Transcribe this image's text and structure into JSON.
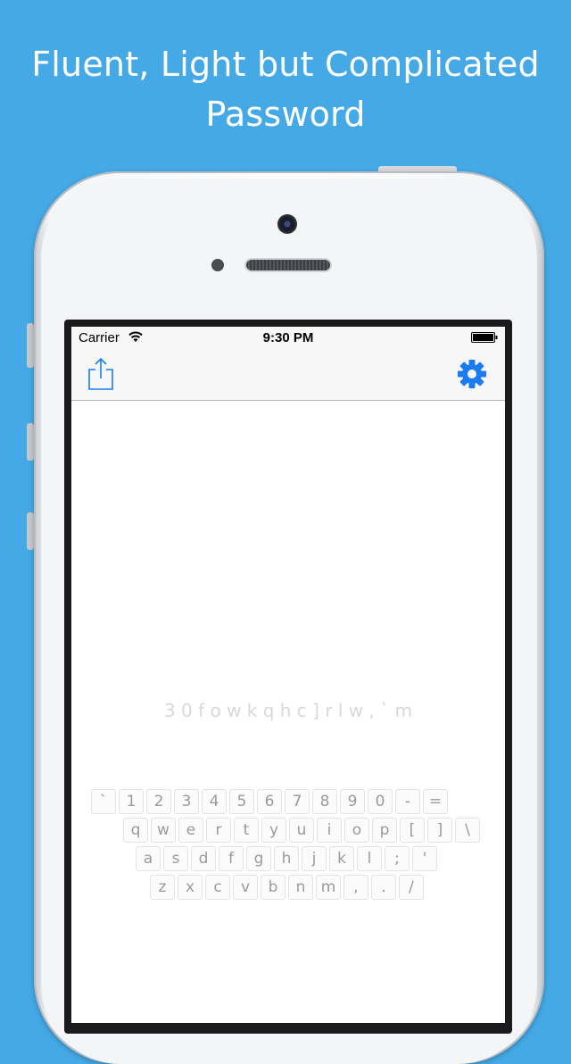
{
  "headline": {
    "line1": "Fluent, Light but Complicated",
    "line2": "Password"
  },
  "status_bar": {
    "carrier": "Carrier",
    "time": "9:30 PM",
    "wifi_icon": "wifi-icon",
    "battery_icon": "battery-icon"
  },
  "nav_bar": {
    "left_icon": "share-icon",
    "right_icon": "gear-icon",
    "accent_color": "#1a7cf0"
  },
  "password_text": "3 0 f o w k q h c ] r l w , ` m",
  "keyboard": {
    "rows": [
      [
        "`",
        "1",
        "2",
        "3",
        "4",
        "5",
        "6",
        "7",
        "8",
        "9",
        "0",
        "-",
        "="
      ],
      [
        "q",
        "w",
        "e",
        "r",
        "t",
        "y",
        "u",
        "i",
        "o",
        "p",
        "[",
        "]",
        "\\"
      ],
      [
        "a",
        "s",
        "d",
        "f",
        "g",
        "h",
        "j",
        "k",
        "l",
        ";",
        "'"
      ],
      [
        "z",
        "x",
        "c",
        "v",
        "b",
        "n",
        "m",
        ",",
        ".",
        "/"
      ]
    ]
  },
  "colors": {
    "background": "#45a9e6",
    "headline_text": "#ffffff",
    "password_text": "#d8d8d8",
    "key_text": "#9a9a9a"
  }
}
